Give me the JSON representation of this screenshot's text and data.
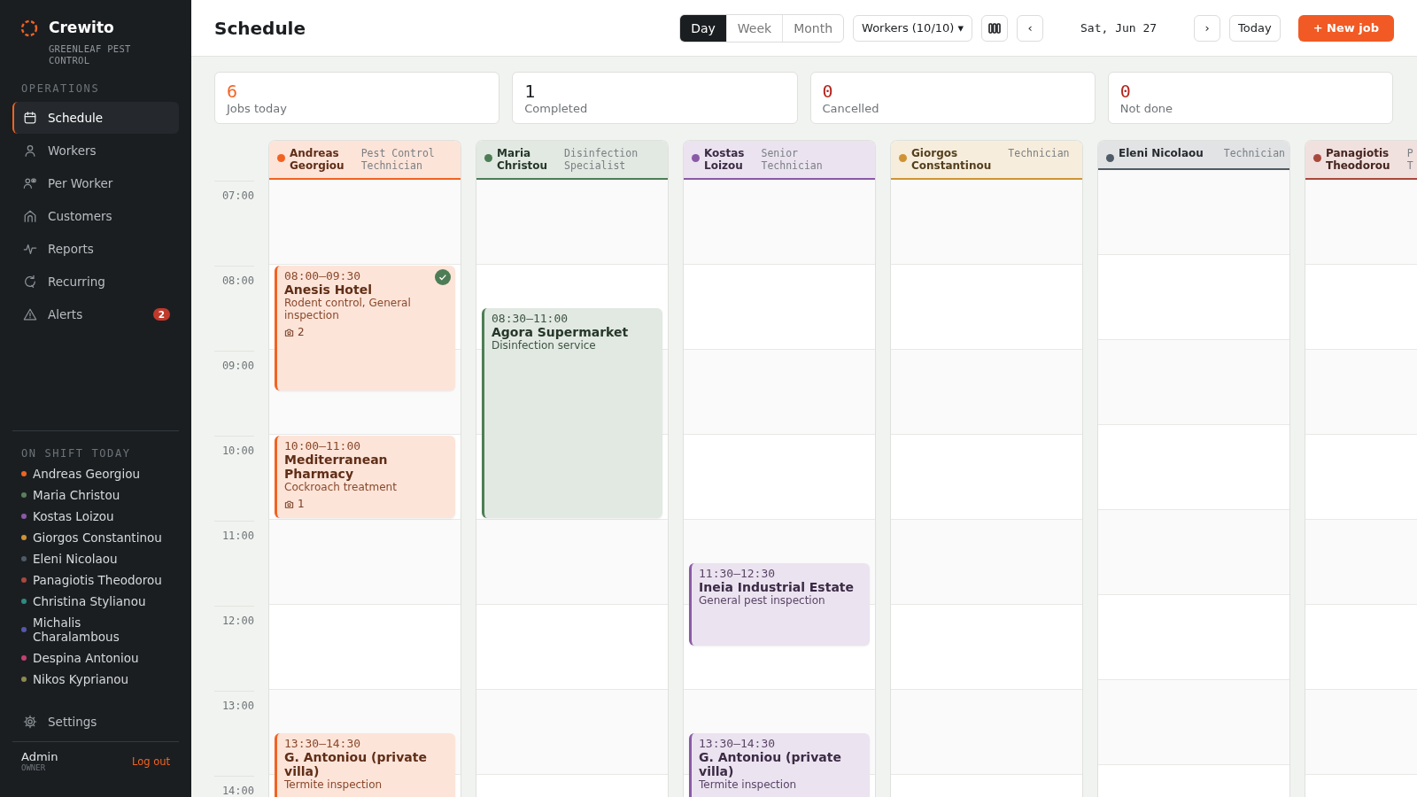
{
  "sidebar": {
    "brand": "Crewito",
    "company": "GREENLEAF PEST CONTROL",
    "section_label": "OPERATIONS",
    "nav": [
      {
        "label": "Schedule",
        "kind": "calendar",
        "selected": true
      },
      {
        "label": "Workers",
        "kind": "person",
        "selected": false
      },
      {
        "label": "Per Worker",
        "kind": "people",
        "selected": false
      },
      {
        "label": "Customers",
        "kind": "house",
        "selected": false
      },
      {
        "label": "Reports",
        "kind": "pulse",
        "selected": false
      },
      {
        "label": "Recurring",
        "kind": "refresh",
        "selected": false
      },
      {
        "label": "Alerts",
        "kind": "warning",
        "selected": false,
        "badge": "2"
      }
    ],
    "shift_label": "ON SHIFT TODAY",
    "on_shift": [
      {
        "name": "Andreas Georgiou",
        "color": "#f26322"
      },
      {
        "name": "Maria Christou",
        "color": "#5a7f5c"
      },
      {
        "name": "Kostas Loizou",
        "color": "#8a5aa6"
      },
      {
        "name": "Giorgos Constantinou",
        "color": "#cf9334"
      },
      {
        "name": "Eleni Nicolaou",
        "color": "#4f5b66"
      },
      {
        "name": "Panagiotis Theodorou",
        "color": "#a8493e"
      },
      {
        "name": "Christina Stylianou",
        "color": "#2f8a83"
      },
      {
        "name": "Michalis Charalambous",
        "color": "#5558a8"
      },
      {
        "name": "Despina Antoniou",
        "color": "#c2416e"
      },
      {
        "name": "Nikos Kyprianou",
        "color": "#8c8a4c"
      }
    ],
    "settings": "Settings",
    "user": {
      "name": "Admin",
      "role": "OWNER"
    },
    "logout": "Log out"
  },
  "topbar": {
    "title": "Schedule",
    "views": [
      {
        "label": "Day",
        "selected": true
      },
      {
        "label": "Week",
        "selected": false
      },
      {
        "label": "Month",
        "selected": false
      }
    ],
    "workers_filter": "Workers (10/10) ▾",
    "prev": "‹",
    "date": "Sat, Jun 27",
    "next": "›",
    "today": "Today",
    "new_job": "+ New job"
  },
  "stats": [
    {
      "value": "6",
      "label": "Jobs today",
      "color": "#f26322"
    },
    {
      "value": "1",
      "label": "Completed",
      "color": "#1b1e21"
    },
    {
      "value": "0",
      "label": "Cancelled",
      "color": "#b3261e"
    },
    {
      "value": "0",
      "label": "Not done",
      "color": "#b3261e"
    }
  ],
  "hours": [
    "07:00",
    "08:00",
    "09:00",
    "10:00",
    "11:00",
    "12:00",
    "13:00",
    "14:00"
  ],
  "columns": [
    {
      "name": "Andreas Georgiou",
      "role": "Pest Control Technician",
      "color": "#f26322",
      "jobs": [
        {
          "time": "08:00–09:30",
          "title": "Anesis Hotel",
          "service": "Rodent control, General inspection",
          "photos": "2",
          "completed": true
        },
        {
          "time": "10:00–11:00",
          "title": "Mediterranean Pharmacy",
          "service": "Cockroach treatment",
          "photos": "1",
          "completed": false
        },
        {
          "time": "13:30–14:30",
          "title": "G. Antoniou (private villa)",
          "service": "Termite inspection",
          "completed": false
        }
      ]
    },
    {
      "name": "Maria Christou",
      "role": "Disinfection Specialist",
      "color": "#4e7d55",
      "jobs": [
        {
          "time": "08:30–11:00",
          "title": "Agora Supermarket",
          "service": "Disinfection service",
          "completed": false
        }
      ]
    },
    {
      "name": "Kostas Loizou",
      "role": "Senior Technician",
      "color": "#8a5aa6",
      "jobs": [
        {
          "time": "11:30–12:30",
          "title": "Ineia Industrial Estate",
          "service": "General pest inspection",
          "completed": false
        },
        {
          "time": "13:30–14:30",
          "title": "G. Antoniou (private villa)",
          "service": "Termite inspection",
          "completed": false
        }
      ]
    },
    {
      "name": "Giorgos Constantinou",
      "role": "Technician",
      "color": "#cf9334"
    },
    {
      "name": "Eleni Nicolaou",
      "role": "Technician",
      "color": "#4f5b66"
    },
    {
      "name": "Panagiotis Theodorou",
      "role": "P\nT",
      "color": "#a8493e"
    }
  ]
}
